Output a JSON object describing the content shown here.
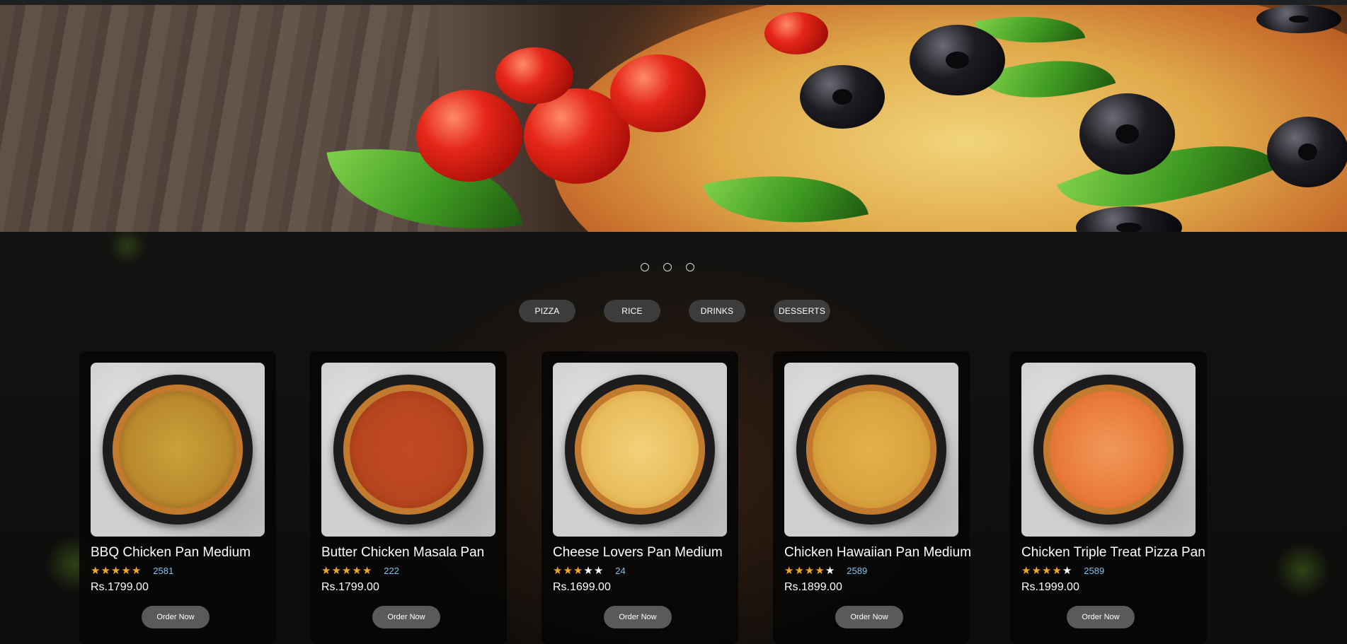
{
  "slider": {
    "dots": 3
  },
  "tabs": [
    "PIZZA",
    "RICE",
    "DRINKS",
    "DESSERTS"
  ],
  "colors": {
    "background": "#0d0c0b",
    "card": "#060606",
    "tab": "#3c3c3c",
    "order_button": "#5a5a5a",
    "star_active": "#f3a71f",
    "rating_count": "#7ec3f3"
  },
  "products": [
    {
      "name": "BBQ Chicken Pan Medium",
      "rating": 4.5,
      "reviews": "2581",
      "price": "Rs.1799.00",
      "button": "Order Now",
      "image": "pizza-image"
    },
    {
      "name": "Butter Chicken Masala Pan",
      "rating": 4.5,
      "reviews": "222",
      "price": "Rs.1799.00",
      "button": "Order Now",
      "image": "pizza-image"
    },
    {
      "name": "Cheese Lovers Pan Medium",
      "rating": 2.5,
      "reviews": "24",
      "price": "Rs.1699.00",
      "button": "Order Now",
      "image": "pizza-image"
    },
    {
      "name": "Chicken Hawaiian Pan Medium",
      "rating": 3.5,
      "reviews": "2589",
      "price": "Rs.1899.00",
      "button": "Order Now",
      "image": "pizza-image"
    },
    {
      "name": "Chicken Triple Treat Pizza Pan",
      "rating": 3.5,
      "reviews": "2589",
      "price": "Rs.1999.00",
      "button": "Order Now",
      "image": "pizza-image"
    }
  ]
}
